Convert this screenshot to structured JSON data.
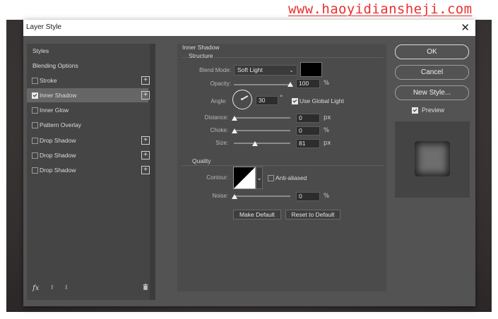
{
  "watermark": "www.haoyidiansheji.com",
  "window": {
    "title": "Layer Style",
    "close_glyph": "✕"
  },
  "styles_list": {
    "items": [
      {
        "label": "Styles",
        "header": true
      },
      {
        "label": "Blending Options",
        "header": true
      },
      {
        "label": "Stroke",
        "checked": false,
        "plus": true
      },
      {
        "label": "Inner Shadow",
        "checked": true,
        "plus": true,
        "active": true
      },
      {
        "label": "Inner Glow",
        "checked": false
      },
      {
        "label": "Pattern Overlay",
        "checked": false
      },
      {
        "label": "Drop Shadow",
        "checked": false,
        "plus": true
      },
      {
        "label": "Drop Shadow",
        "checked": false,
        "plus": true
      },
      {
        "label": "Drop Shadow",
        "checked": false,
        "plus": true
      }
    ],
    "plus_glyph": "+",
    "footer": {
      "fx": "fx",
      "up_glyph": "⬆",
      "down_glyph": "⬇"
    }
  },
  "inner_shadow": {
    "title": "Inner Shadow",
    "structure_title": "Structure",
    "blend_mode_label": "Blend Mode:",
    "blend_mode_value": "Soft Light",
    "blend_color": "#000000",
    "opacity_label": "Opacity:",
    "opacity_value": "100",
    "opacity_unit": "%",
    "angle_label": "Angle:",
    "angle_value": "30",
    "angle_unit": "°",
    "use_global_light_label": "Use Global Light",
    "use_global_light": true,
    "distance_label": "Distance:",
    "distance_value": "0",
    "distance_unit": "px",
    "choke_label": "Choke:",
    "choke_value": "0",
    "choke_unit": "%",
    "size_label": "Size:",
    "size_value": "81",
    "size_unit": "px",
    "quality_title": "Quality",
    "contour_label": "Contour:",
    "anti_aliased_label": "Anti-aliased",
    "anti_aliased": false,
    "noise_label": "Noise:",
    "noise_value": "0",
    "noise_unit": "%",
    "make_default_label": "Make Default",
    "reset_default_label": "Reset to Default",
    "dropdown_glyph": "⌄"
  },
  "actions": {
    "ok_label": "OK",
    "cancel_label": "Cancel",
    "new_style_label": "New Style...",
    "preview_label": "Preview",
    "preview_checked": true
  }
}
